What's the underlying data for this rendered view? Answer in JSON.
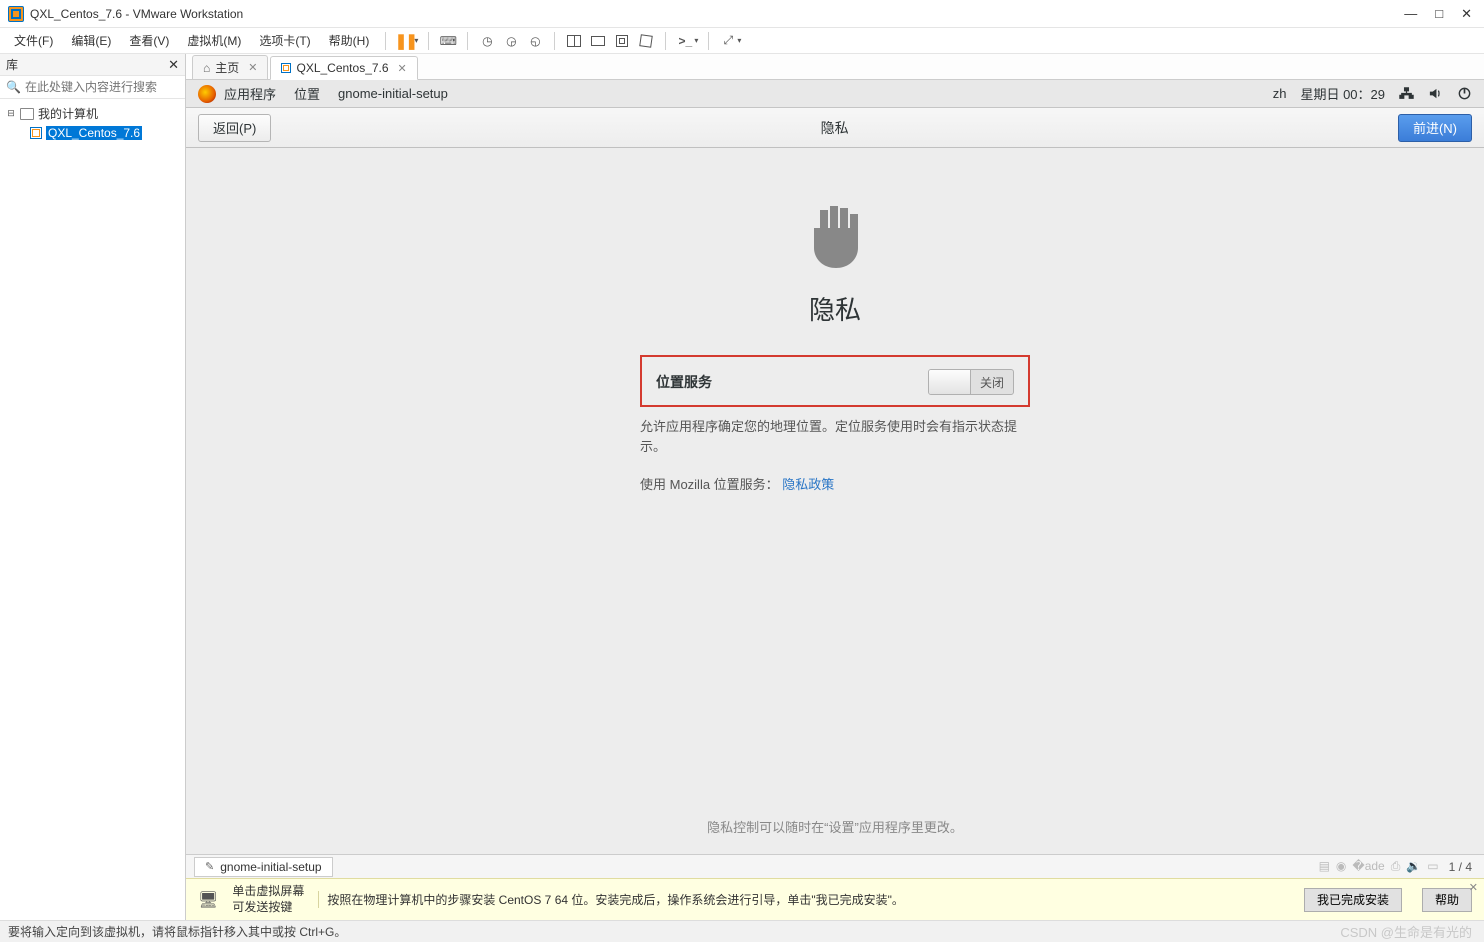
{
  "titlebar": {
    "title": "QXL_Centos_7.6 - VMware Workstation"
  },
  "menubar": {
    "items": [
      "文件(F)",
      "编辑(E)",
      "查看(V)",
      "虚拟机(M)",
      "选项卡(T)",
      "帮助(H)"
    ]
  },
  "sidebar": {
    "header": "库",
    "search_placeholder": "在此处键入内容进行搜索",
    "root": "我的计算机",
    "vm": "QXL_Centos_7.6"
  },
  "tabs": {
    "home": "主页",
    "vm": "QXL_Centos_7.6"
  },
  "gnome": {
    "topbar": {
      "apps": "应用程序",
      "places": "位置",
      "active": "gnome-initial-setup",
      "lang": "zh",
      "clock": "星期日 00：29"
    },
    "header": {
      "back": "返回(P)",
      "title": "隐私",
      "next": "前进(N)"
    },
    "body": {
      "heading": "隐私",
      "location_label": "位置服务",
      "switch_label": "关闭",
      "desc": "允许应用程序确定您的地理位置。定位服务使用时会有指示状态提示。",
      "desc2_prefix": "使用  Mozilla 位置服务： ",
      "desc2_link": "隐私政策",
      "footer": "隐私控制可以随时在“设置”应用程序里更改。"
    }
  },
  "taskrow": {
    "task": "gnome-initial-setup",
    "pager": "1 / 4"
  },
  "hintbar": {
    "line1": "单击虚拟屏幕",
    "line2": "可发送按键",
    "msg": "按照在物理计算机中的步骤安装 CentOS 7 64 位。安装完成后，操作系统会进行引导，单击\"我已完成安装\"。",
    "btn1": "我已完成安装",
    "btn2": "帮助"
  },
  "statusbar": {
    "text": "要将输入定向到该虚拟机，请将鼠标指针移入其中或按 Ctrl+G。",
    "watermark": "CSDN @生命是有光的"
  }
}
